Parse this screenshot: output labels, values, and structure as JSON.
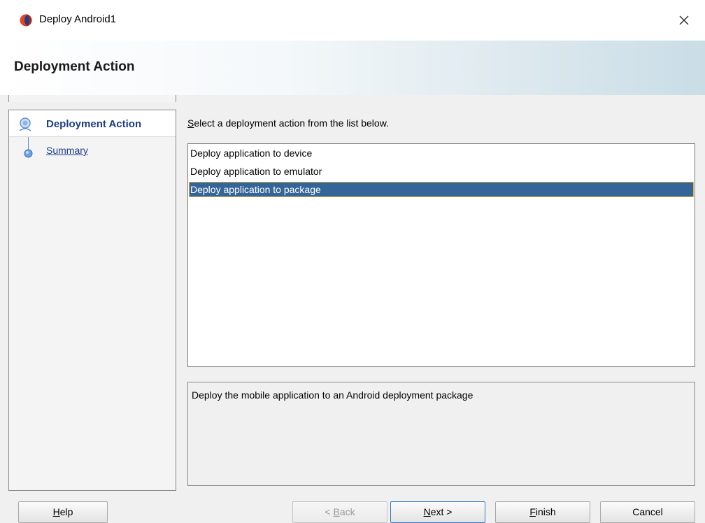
{
  "window": {
    "title": "Deploy Android1",
    "close_glyph": "✕"
  },
  "header": {
    "title": "Deployment Action"
  },
  "nav": {
    "steps": [
      {
        "label": "Deployment Action",
        "active": true
      },
      {
        "label": "Summary",
        "active": false
      }
    ]
  },
  "main": {
    "instruction_mnemonic": "S",
    "instruction_rest": "elect a deployment action from the list below.",
    "actions": [
      "Deploy application to device",
      "Deploy application to emulator",
      "Deploy application to package"
    ],
    "selected_index": 2,
    "description": "Deploy the mobile application to an Android deployment package"
  },
  "buttons": {
    "help_mn": "H",
    "help_rest": "elp",
    "back_pre": "< ",
    "back_mn": "B",
    "back_rest": "ack",
    "next_mn": "N",
    "next_rest": "ext >",
    "finish_mn": "F",
    "finish_rest": "inish",
    "cancel": "Cancel"
  },
  "colors": {
    "selection_bg": "#336598",
    "selection_border": "#e7b33b",
    "nav_active_text": "#1e3c82",
    "link_text": "#1c3c8c"
  }
}
